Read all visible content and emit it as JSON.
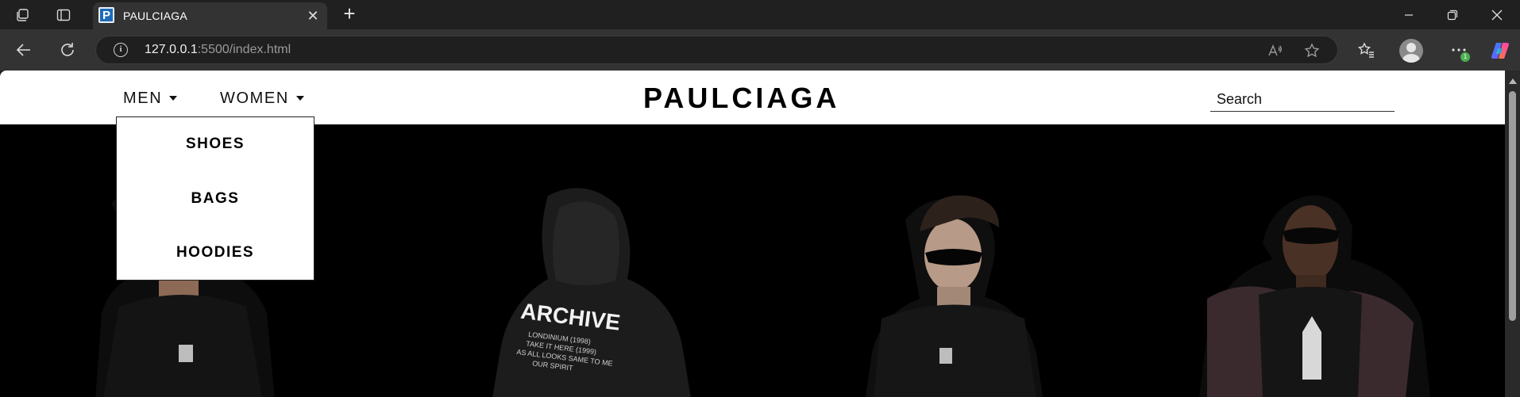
{
  "browser": {
    "tab_title": "PAULCIAGA",
    "tab_favicon_letter": "P",
    "url_host": "127.0.0.1",
    "url_rest": ":5500/index.html",
    "icons": [
      "workspaces-icon",
      "tab-actions-icon",
      "back-icon",
      "refresh-icon",
      "site-info-icon",
      "read-aloud-icon",
      "favorite-star-icon",
      "favorites-icon",
      "profile-avatar",
      "more-icon",
      "copilot-icon",
      "minimize-icon",
      "restore-icon",
      "close-icon"
    ],
    "notification_badge": "1"
  },
  "site": {
    "logo": "PAULCIAGA",
    "nav": [
      {
        "label": "MEN",
        "expanded": true
      },
      {
        "label": "WOMEN",
        "expanded": false
      }
    ],
    "dropdown_items": [
      "SHOES",
      "BAGS",
      "HOODIES"
    ],
    "search_placeholder": "Search",
    "hero_print": [
      "ARCHIVE",
      "LONDINIUM (1998)",
      "TAKE IT HERE (1999)",
      "AS ALL LOOKS SAME TO ME",
      "OUR SPIRIT"
    ],
    "colors": {
      "header_bg": "#ffffff",
      "hero_bg": "#000000",
      "text": "#000000"
    }
  }
}
